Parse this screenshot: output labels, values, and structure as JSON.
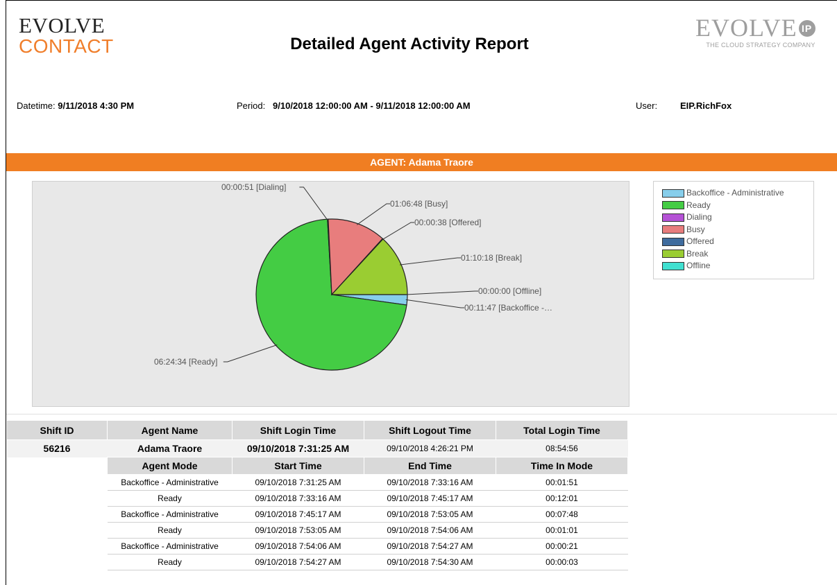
{
  "header": {
    "logo_left_line1": "EVOLVE",
    "logo_left_line2": "CONTACT",
    "title": "Detailed Agent Activity Report",
    "logo_right_line1": "EVOLVE",
    "logo_right_badge": "IP",
    "logo_right_tagline": "THE CLOUD STRATEGY COMPANY"
  },
  "meta": {
    "datetime_label": "Datetime:",
    "datetime_value": "9/11/2018 4:30 PM",
    "period_label": "Period:",
    "period_value": "9/10/2018 12:00:00 AM - 9/11/2018 12:00:00 AM",
    "user_label": "User:",
    "user_value": "EIP.RichFox"
  },
  "agent_banner": "AGENT: Adama Traore",
  "colors": {
    "accent": "#f07e22",
    "backoffice": "#87ceeb",
    "ready": "#44cc44",
    "dialing": "#b552d6",
    "busy": "#e87d7d",
    "offered": "#3f6c9e",
    "break": "#9acd32",
    "offline": "#40e0d0"
  },
  "chart_data": {
    "type": "pie",
    "slices": [
      {
        "name": "Backoffice - Administrative",
        "value": "00:11:47",
        "seconds": 707,
        "label": "00:11:47 [Backoffice -…",
        "color": "#87ceeb"
      },
      {
        "name": "Ready",
        "value": "06:24:34",
        "seconds": 23074,
        "label": "06:24:34 [Ready]",
        "color": "#44cc44"
      },
      {
        "name": "Dialing",
        "value": "00:00:51",
        "seconds": 51,
        "label": "00:00:51 [Dialing]",
        "color": "#b552d6"
      },
      {
        "name": "Busy",
        "value": "01:06:48",
        "seconds": 4008,
        "label": "01:06:48 [Busy]",
        "color": "#e87d7d"
      },
      {
        "name": "Offered",
        "value": "00:00:38",
        "seconds": 38,
        "label": "00:00:38 [Offered]",
        "color": "#3f6c9e"
      },
      {
        "name": "Break",
        "value": "01:10:18",
        "seconds": 4218,
        "label": "01:10:18 [Break]",
        "color": "#9acd32"
      },
      {
        "name": "Offline",
        "value": "00:00:00",
        "seconds": 0,
        "label": "00:00:00 [Offline]",
        "color": "#40e0d0"
      }
    ],
    "legend": [
      "Backoffice - Administrative",
      "Ready",
      "Dialing",
      "Busy",
      "Offered",
      "Break",
      "Offline"
    ],
    "legend_position": "right"
  },
  "shift_table": {
    "headers": [
      "Shift ID",
      "Agent Name",
      "Shift Login Time",
      "Shift Logout Time",
      "Total Login Time"
    ],
    "row": [
      "56216",
      "Adama Traore",
      "09/10/2018 7:31:25 AM",
      "09/10/2018 4:26:21 PM",
      "08:54:56"
    ]
  },
  "mode_table": {
    "headers": [
      "Agent Mode",
      "Start Time",
      "End Time",
      "Time In Mode"
    ],
    "rows": [
      [
        "Backoffice - Administrative",
        "09/10/2018 7:31:25 AM",
        "09/10/2018 7:33:16 AM",
        "00:01:51"
      ],
      [
        "Ready",
        "09/10/2018 7:33:16 AM",
        "09/10/2018 7:45:17 AM",
        "00:12:01"
      ],
      [
        "Backoffice - Administrative",
        "09/10/2018 7:45:17 AM",
        "09/10/2018 7:53:05 AM",
        "00:07:48"
      ],
      [
        "Ready",
        "09/10/2018 7:53:05 AM",
        "09/10/2018 7:54:06 AM",
        "00:01:01"
      ],
      [
        "Backoffice - Administrative",
        "09/10/2018 7:54:06 AM",
        "09/10/2018 7:54:27 AM",
        "00:00:21"
      ],
      [
        "Ready",
        "09/10/2018 7:54:27 AM",
        "09/10/2018 7:54:30 AM",
        "00:00:03"
      ]
    ]
  }
}
